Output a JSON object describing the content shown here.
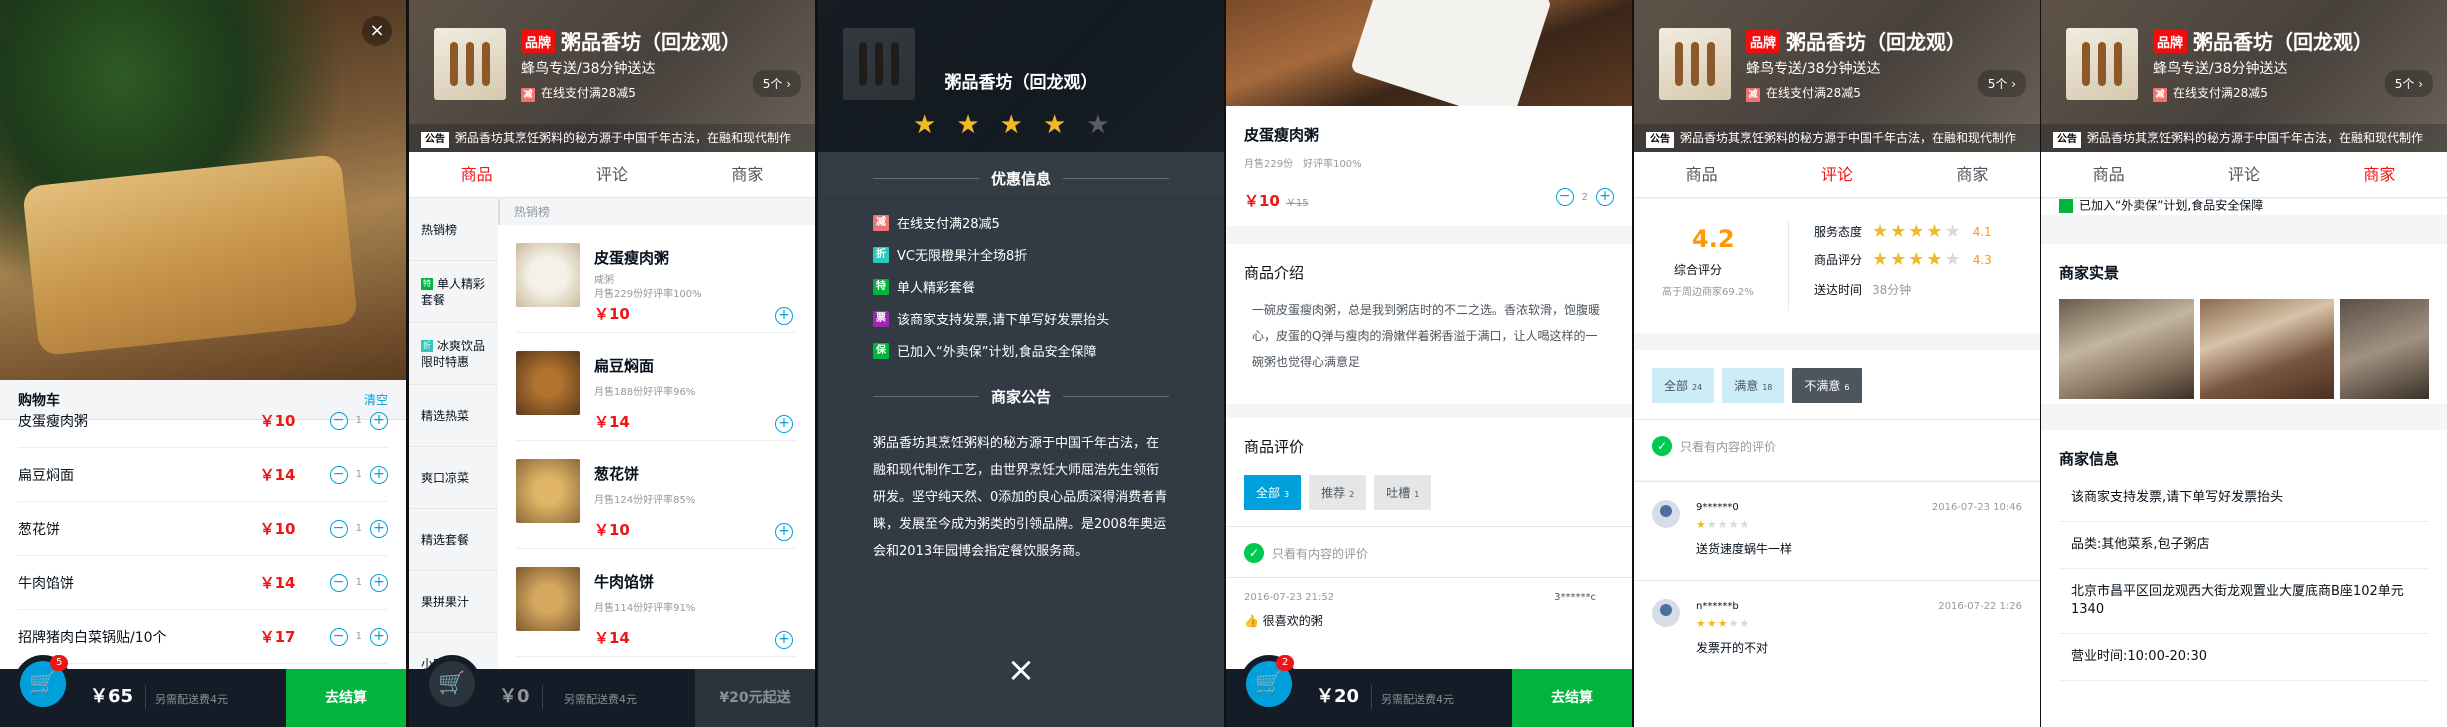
{
  "shop": {
    "brand_badge": "品牌",
    "name": "粥品香坊（回龙观）",
    "delivery": "蜂鸟专送/38分钟送达",
    "promo_icon": "减",
    "promo_text": "在线支付满28减5",
    "more": "5个",
    "notice_badge": "公告",
    "notice": "粥品香坊其烹饪粥料的秘方源于中国千年古法，在融和现代制作"
  },
  "tabs": [
    "商品",
    "评论",
    "商家"
  ],
  "cart_bar": {
    "fee_text": "另需配送费4元",
    "checkout": "去结算",
    "min_order": "¥20元起送"
  },
  "panel1": {
    "close_icon": "×",
    "cart_title": "购物车",
    "clear": "清空",
    "items": [
      {
        "name": "皮蛋瘦肉粥",
        "price": "￥10",
        "count": "1"
      },
      {
        "name": "扁豆焖面",
        "price": "￥14",
        "count": "1"
      },
      {
        "name": "葱花饼",
        "price": "￥10",
        "count": "1"
      },
      {
        "name": "牛肉馅饼",
        "price": "￥14",
        "count": "1"
      },
      {
        "name": "招牌猪肉白菜锅贴/10个",
        "price": "￥17",
        "count": "1"
      }
    ],
    "badge": "5",
    "total": "￥65"
  },
  "panel2": {
    "menu": [
      {
        "icon": "",
        "label": "热销榜"
      },
      {
        "icon": "特",
        "label": "单人精彩套餐"
      },
      {
        "icon": "折",
        "label": "冰爽饮品限时特惠"
      },
      {
        "icon": "",
        "label": "精选热菜"
      },
      {
        "icon": "",
        "label": "爽口凉菜"
      },
      {
        "icon": "",
        "label": "精选套餐"
      },
      {
        "icon": "",
        "label": "果拼果汁"
      },
      {
        "icon": "",
        "label": "小吃主食"
      }
    ],
    "category": "热销榜",
    "foods": [
      {
        "name": "皮蛋瘦肉粥",
        "desc": "咸粥",
        "stats": "月售229份好评率100%",
        "price": "￥10"
      },
      {
        "name": "扁豆焖面",
        "desc": "",
        "stats": "月售188份好评率96%",
        "price": "￥14"
      },
      {
        "name": "葱花饼",
        "desc": "",
        "stats": "月售124份好评率85%",
        "price": "￥10"
      },
      {
        "name": "牛肉馅饼",
        "desc": "",
        "stats": "月售114份好评率91%",
        "price": "￥14"
      }
    ],
    "total": "￥0"
  },
  "panel3": {
    "title": "粥品香坊（回龙观）",
    "stars_on": 4,
    "promo_header": "优惠信息",
    "promos": [
      {
        "icon": "减",
        "color": "#f07373",
        "text": "在线支付满28减5"
      },
      {
        "icon": "折",
        "color": "#2ac8bd",
        "text": "VC无限橙果汁全场8折"
      },
      {
        "icon": "特",
        "color": "#00b43c",
        "text": "单人精彩套餐"
      },
      {
        "icon": "票",
        "color": "#9c27b0",
        "text": "该商家支持发票,请下单写好发票抬头"
      },
      {
        "icon": "保",
        "color": "#00b43c",
        "text": "已加入“外卖保”计划,食品安全保障"
      }
    ],
    "bulletin_header": "商家公告",
    "bulletin": "粥品香坊其烹饪粥料的秘方源于中国千年古法，在融和现代制作工艺，由世界烹饪大师屈浩先生领衔研发。坚守纯天然、0添加的良心品质深得消费者青睐，发展至今成为粥类的引领品牌。是2008年奥运会和2013年园博会指定餐饮服务商。",
    "close": "×"
  },
  "panel4": {
    "name": "皮蛋瘦肉粥",
    "stats": "月售229份　好评率100%",
    "price": "￥10",
    "old_price": "￥15",
    "count": "2",
    "intro_title": "商品介绍",
    "intro": "一碗皮蛋瘦肉粥，总是我到粥店时的不二之选。香浓软滑，饱腹暖心，皮蛋的Q弹与瘦肉的滑嫩伴着粥香溢于满口，让人喝这样的一碗粥也觉得心满意足",
    "rating_title": "商品评价",
    "rtabs": [
      {
        "label": "全部",
        "n": "3"
      },
      {
        "label": "推荐",
        "n": "2"
      },
      {
        "label": "吐槽",
        "n": "1"
      }
    ],
    "only_content": "只看有内容的评价",
    "review": {
      "time": "2016-07-23 21:52",
      "user": "3******c",
      "text": "很喜欢的粥"
    },
    "badge": "2",
    "total": "￥20"
  },
  "panel5": {
    "score": "4.2",
    "score_label": "综合评分",
    "beat": "高于周边商家69.2%",
    "service_label": "服务态度",
    "service_val": "4.1",
    "food_label": "商品评分",
    "food_val": "4.3",
    "time_label": "送达时间",
    "time_val": "38分钟",
    "rtabs": [
      {
        "label": "全部",
        "n": "24"
      },
      {
        "label": "满意",
        "n": "18"
      },
      {
        "label": "不满意",
        "n": "6"
      }
    ],
    "only_content": "只看有内容的评价",
    "reviews": [
      {
        "user": "9******0",
        "time": "2016-07-23 10:46",
        "stars": 1,
        "text": "送货速度蜗牛一样"
      },
      {
        "user": "n******b",
        "time": "2016-07-22 1:26",
        "stars": 3,
        "text": "发票开的不对"
      }
    ]
  },
  "panel6": {
    "top_note": "已加入“外卖保”计划,食品安全保障",
    "photos_title": "商家实景",
    "info_title": "商家信息",
    "info": [
      "该商家支持发票,请下单写好发票抬头",
      "品类:其他菜系,包子粥店",
      "北京市昌平区回龙观西大街龙观置业大厦底商B座102单元1340",
      "营业时间:10:00-20:30"
    ]
  }
}
